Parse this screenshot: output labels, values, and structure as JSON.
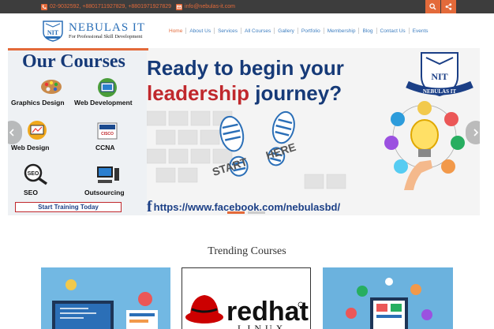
{
  "topbar": {
    "phones": "02-9032592, +8801711927829, +8801971927829",
    "email": "info@nebulas-it.com",
    "search_icon": "search-icon",
    "share_icon": "share-icon",
    "accent_color": "#e36a3a",
    "bg_color": "#3d3d3d"
  },
  "logo": {
    "name": "NEBULAS IT",
    "tagline": "For Professional Skill Development",
    "mark_text": "NIT"
  },
  "nav": {
    "items": [
      {
        "label": "Home",
        "active": true
      },
      {
        "label": "About Us",
        "active": false
      },
      {
        "label": "Services",
        "active": false
      },
      {
        "label": "All Courses",
        "active": false
      },
      {
        "label": "Gallery",
        "active": false
      },
      {
        "label": "Portfolio",
        "active": false
      },
      {
        "label": "Membership",
        "active": false
      },
      {
        "label": "Blog",
        "active": false
      },
      {
        "label": "Contact Us",
        "active": false
      },
      {
        "label": "Events",
        "active": false
      }
    ]
  },
  "hero": {
    "courses_title": "Our Courses",
    "courses": [
      {
        "label": "Graphics Design",
        "icon": "palette-icon"
      },
      {
        "label": "Web Development",
        "icon": "monitor-icon"
      },
      {
        "label": "Web Design",
        "icon": "web-design-icon"
      },
      {
        "label": "CCNA",
        "icon": "cisco-icon"
      },
      {
        "label": "SEO",
        "icon": "seo-icon"
      },
      {
        "label": "Outsourcing",
        "icon": "computer-icon"
      }
    ],
    "cta": "Start Training Today",
    "headline_line1": "Ready to begin your",
    "headline_red": "leadership",
    "headline_blue": " journey?",
    "start_text": "START",
    "here_text": "HERE",
    "logo_text": "NEBULAS IT",
    "facebook_url": "https://www.facebook.com/nebulasbd/",
    "facebook_icon": "facebook-icon"
  },
  "trending": {
    "title": "Trending Courses",
    "cards": [
      {
        "name": "course-card-web"
      },
      {
        "name": "course-card-redhat",
        "brand": "redhat",
        "sub": "LINUX"
      },
      {
        "name": "course-card-digital"
      }
    ]
  }
}
